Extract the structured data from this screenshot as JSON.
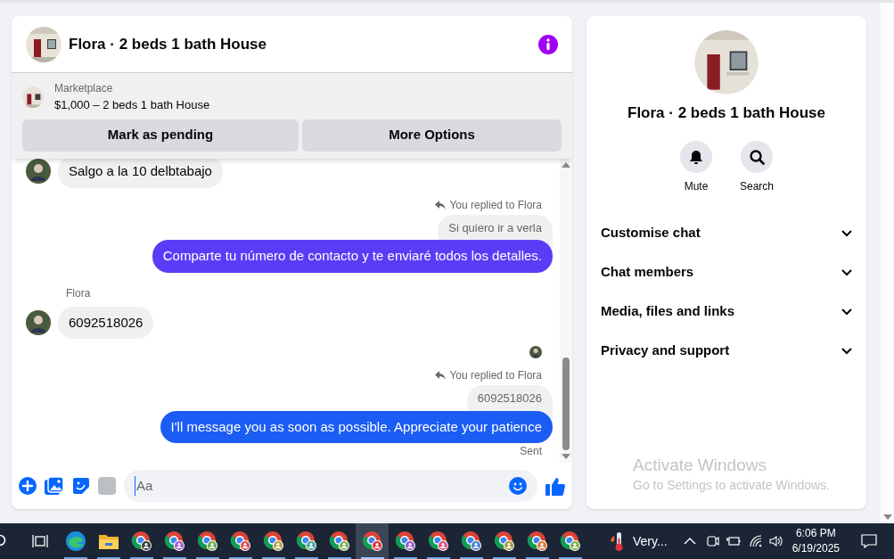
{
  "chat": {
    "title": "Flora · 2 beds 1 bath House",
    "listing": {
      "source": "Marketplace",
      "summary": "$1,000 – 2 beds 1 bath House",
      "actions": [
        "Mark as pending",
        "More Options"
      ]
    },
    "messages": [
      {
        "kind": "incoming",
        "text": "Salgo a la 10 delbtabajo"
      },
      {
        "kind": "reply_note",
        "text": "You replied to Flora"
      },
      {
        "kind": "quoted",
        "text": "Si quiero ir a verla"
      },
      {
        "kind": "outgoing",
        "text": "Comparte tu número de contacto y te enviaré todos los detalles.",
        "color": "#5b3cf6"
      },
      {
        "kind": "sender",
        "text": "Flora"
      },
      {
        "kind": "incoming",
        "text": "6092518026"
      },
      {
        "kind": "seen"
      },
      {
        "kind": "reply_note",
        "text": "You replied to Flora"
      },
      {
        "kind": "quoted",
        "text": "6092518026"
      },
      {
        "kind": "outgoing",
        "text": "I'll message you as soon as possible. Appreciate your patience",
        "color": "#1b5cf3"
      },
      {
        "kind": "status",
        "text": "Sent"
      }
    ],
    "composer": {
      "placeholder": "Aa"
    }
  },
  "details": {
    "title": "Flora · 2 beds 1 bath House",
    "actions": [
      {
        "kind": "mute",
        "label": "Mute"
      },
      {
        "kind": "search",
        "label": "Search"
      }
    ],
    "sections": [
      {
        "label": "Customise chat",
        "expanded": false
      },
      {
        "label": "Chat members",
        "expanded": false
      },
      {
        "label": "Media, files and links",
        "expanded": false
      },
      {
        "label": "Privacy and support",
        "expanded": false
      }
    ]
  },
  "activation_notice": {
    "title": "Activate Windows",
    "text": "Go to Settings to activate Windows."
  },
  "taskbar": {
    "apps": [
      {
        "kind": "edge",
        "selected": false
      },
      {
        "kind": "files",
        "selected": false
      },
      {
        "kind": "chrome",
        "color": "#3c3c3c",
        "selected": false
      },
      {
        "kind": "chrome",
        "color": "#a35bd6",
        "selected": false
      },
      {
        "kind": "chrome",
        "color": "#6aa84f",
        "selected": false
      },
      {
        "kind": "chrome",
        "color": "#e04a5f",
        "selected": false
      },
      {
        "kind": "chrome",
        "color": "#b5a24a",
        "selected": false
      },
      {
        "kind": "chrome",
        "color": "#3fa7a3",
        "selected": false
      },
      {
        "kind": "chrome",
        "color": "#7cb35a",
        "selected": false
      },
      {
        "kind": "chrome",
        "color": "#e0323e",
        "selected": true
      },
      {
        "kind": "chrome",
        "color": "#9b59d0",
        "selected": false
      },
      {
        "kind": "chrome",
        "color": "#e0508c",
        "selected": false
      },
      {
        "kind": "chrome",
        "color": "#4a7ed6",
        "selected": false
      },
      {
        "kind": "chrome",
        "color": "#a59a3e",
        "selected": false
      },
      {
        "kind": "chrome",
        "color": "#e0763a",
        "selected": false
      },
      {
        "kind": "chrome",
        "color": "#79b04f",
        "selected": false
      }
    ],
    "weather": "Very...",
    "time": "6:06 PM",
    "date": "6/19/2025"
  }
}
